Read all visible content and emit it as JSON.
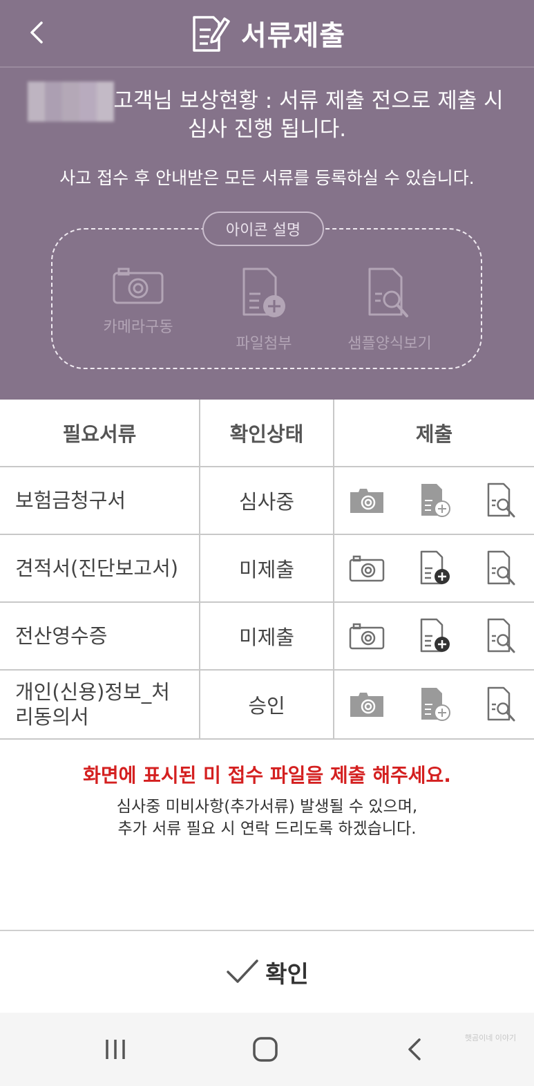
{
  "header": {
    "title": "서류제출",
    "status_text": "고객님 보상현황 : 서류 제출 전으로 제출 시",
    "status_text_2": "심사 진행 됩니다.",
    "guide_text": "사고 접수 후 안내받은 모든 서류를 등록하실 수 있습니다."
  },
  "icon_legend": {
    "title": "아이콘 설명",
    "items": [
      {
        "label": "카메라구동",
        "icon": "camera-icon"
      },
      {
        "label": "파일첨부",
        "icon": "file-attach-icon"
      },
      {
        "label": "샘플양식보기",
        "icon": "sample-view-icon"
      }
    ]
  },
  "table": {
    "headers": [
      "필요서류",
      "확인상태",
      "제출"
    ],
    "rows": [
      {
        "name": "보험금청구서",
        "status": "심사중",
        "enabled": false
      },
      {
        "name": "견적서(진단보고서)",
        "status": "미제출",
        "enabled": true
      },
      {
        "name": "전산영수증",
        "status": "미제출",
        "enabled": true
      },
      {
        "name": "개인(신용)정보_처리동의서",
        "name_line1": "개인(신용)정보_처",
        "name_line2": "리동의서",
        "status": "승인",
        "enabled": false
      }
    ]
  },
  "notice": {
    "highlight": "화면에 표시된 미 접수 파일을 제출 해주세요.",
    "line1": "심사중 미비사항(추가서류) 발생될 수 있으며,",
    "line2": "추가 서류 필요 시 연락 드리도록 하겠습니다."
  },
  "confirm": {
    "label": "확인"
  },
  "watermark": {
    "line1": "햇곰이네 이야기"
  },
  "colors": {
    "header_bg": "#85738a",
    "notice_red": "#d42020",
    "icon_disabled": "#9a9a9a",
    "icon_active": "#6f6f6f"
  }
}
